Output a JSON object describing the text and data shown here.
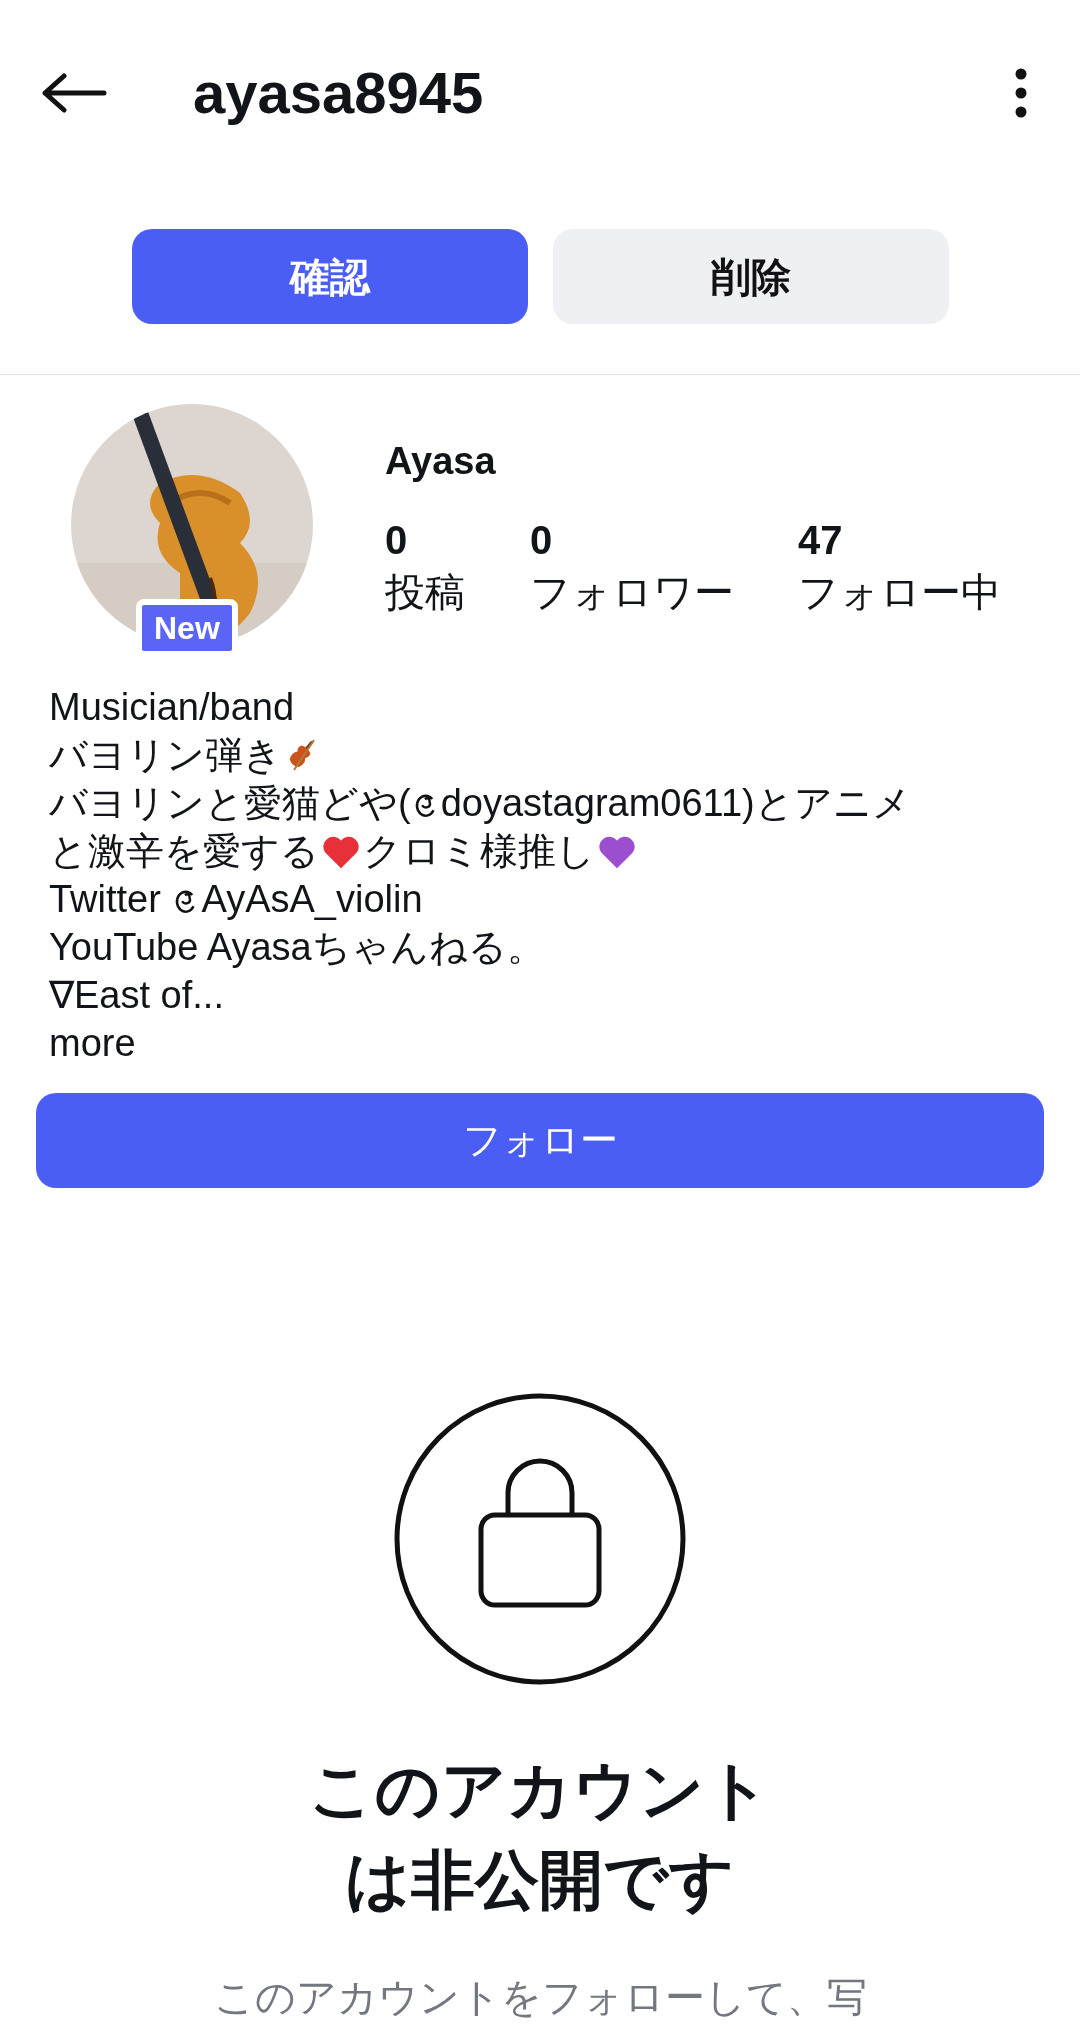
{
  "header": {
    "title": "ayasa8945"
  },
  "request_buttons": [
    {
      "label": "確認",
      "kind": "primary"
    },
    {
      "label": "削除",
      "kind": "secondary"
    }
  ],
  "profile": {
    "badge": "New",
    "name": "Ayasa",
    "stats": [
      {
        "value": "0",
        "label": "投稿"
      },
      {
        "value": "0",
        "label": "フォロワー"
      },
      {
        "value": "47",
        "label": "フォロー中"
      }
    ]
  },
  "bio": [
    [
      {
        "kind": "text",
        "text": "Musician/band"
      }
    ],
    [
      {
        "kind": "text",
        "text": "バヨリン弾き"
      },
      {
        "kind": "violin"
      }
    ],
    [
      {
        "kind": "text",
        "text": "バヨリンと愛猫どや("
      },
      {
        "kind": "threads"
      },
      {
        "kind": "text",
        "text": "doyastagram0611)とアニメ"
      }
    ],
    [
      {
        "kind": "text",
        "text": "と激辛を愛する"
      },
      {
        "kind": "heart",
        "color": "#e8303a"
      },
      {
        "kind": "text",
        "text": "クロミ様推し"
      },
      {
        "kind": "heart",
        "color": "#9b4fd0"
      }
    ],
    [
      {
        "kind": "text",
        "text": "Twitter "
      },
      {
        "kind": "threads"
      },
      {
        "kind": "text",
        "text": "AyAsA_violin"
      }
    ],
    [
      {
        "kind": "text",
        "text": "YouTube Ayasaちゃんねる。"
      }
    ],
    [
      {
        "kind": "text",
        "text": "∇East of..."
      }
    ]
  ],
  "more_link": "more",
  "follow_button": "フォロー",
  "private": {
    "title_lines": [
      "このアカウント",
      "は非公開です"
    ],
    "subtitle": "このアカウントをフォローして、写"
  }
}
